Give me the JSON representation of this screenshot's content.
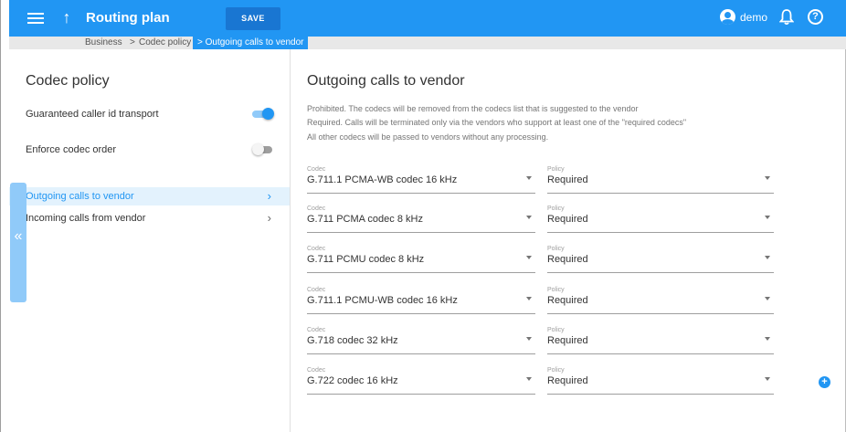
{
  "header": {
    "title": "Routing plan",
    "save_label": "SAVE",
    "user_name": "demo",
    "icons": {
      "menu": "menu-icon",
      "up": "arrow-up-icon",
      "user": "account-circle-icon",
      "bell": "bell-icon",
      "help": "help-icon"
    }
  },
  "breadcrumb": {
    "items": [
      "Business",
      "Codec policy"
    ],
    "active": "Outgoing calls to vendor"
  },
  "sidebar": {
    "title": "Codec policy",
    "toggles": [
      {
        "label": "Guaranteed caller id transport",
        "on": true
      },
      {
        "label": "Enforce codec order",
        "on": false
      }
    ],
    "nav": [
      {
        "label": "Outgoing calls to vendor",
        "selected": true
      },
      {
        "label": "Incoming calls from vendor",
        "selected": false
      }
    ],
    "collapse_glyph": "«"
  },
  "main": {
    "title": "Outgoing calls to vendor",
    "description": [
      "Prohibited. The codecs will be removed from the codecs list that is suggested to the vendor",
      "Required. Calls will be terminated only via the vendors who support at least one of the \"required codecs\"",
      "All other codecs will be passed to vendors without any processing."
    ],
    "codec_label": "Codec",
    "policy_label": "Policy",
    "rows": [
      {
        "codec": "G.711.1 PCMA-WB codec 16 kHz",
        "policy": "Required"
      },
      {
        "codec": "G.711 PCMA codec 8 kHz",
        "policy": "Required"
      },
      {
        "codec": "G.711 PCMU codec 8 kHz",
        "policy": "Required"
      },
      {
        "codec": "G.711.1 PCMU-WB codec 16 kHz",
        "policy": "Required"
      },
      {
        "codec": "G.718 codec 32 kHz",
        "policy": "Required"
      },
      {
        "codec": "G.722 codec 16 kHz",
        "policy": "Required"
      }
    ],
    "add_glyph": "+"
  },
  "colors": {
    "accent": "#2196f3",
    "accent_dark": "#1976d2",
    "selected_bg": "#e3f2fd"
  }
}
